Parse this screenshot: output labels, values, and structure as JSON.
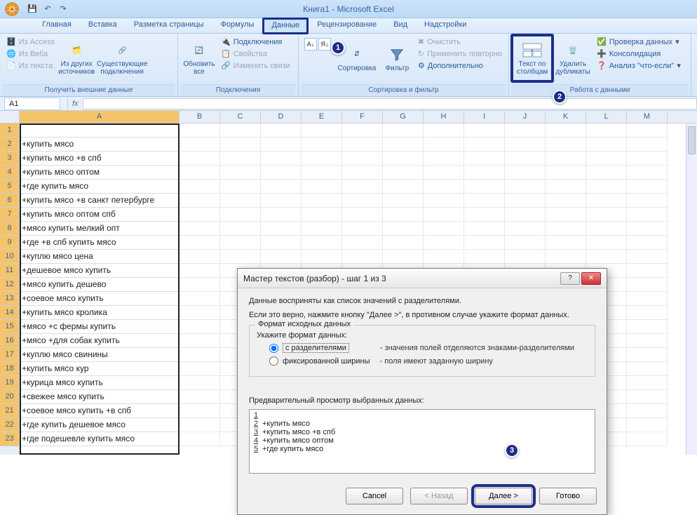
{
  "title": "Книга1  -  Microsoft Excel",
  "qat": {
    "save": "💾",
    "undo": "↶",
    "redo": "↷"
  },
  "tabs": [
    "Главная",
    "Вставка",
    "Разметка страницы",
    "Формулы",
    "Данные",
    "Рецензирование",
    "Вид",
    "Надстройки"
  ],
  "active_tab_index": 4,
  "ribbon": {
    "g_ext": {
      "label": "Получить внешние данные",
      "access": "Из Access",
      "web": "Из Веба",
      "text": "Из текста",
      "other": "Из других источников",
      "existing": "Существующие подключения"
    },
    "g_conn": {
      "label": "Подключения",
      "refresh": "Обновить все",
      "connections": "Подключения",
      "properties": "Свойства",
      "edit_links": "Изменить связи"
    },
    "g_sort": {
      "label": "Сортировка и фильтр",
      "sort": "Сортировка",
      "filter": "Фильтр",
      "clear": "Очистить",
      "reapply": "Применить повторно",
      "advanced": "Дополнительно"
    },
    "g_data": {
      "label": "Работа с данными",
      "text_to_cols": "Текст по столбцам",
      "dedupe": "Удалить дубликаты",
      "validation": "Проверка данных",
      "consolidate": "Консолидация",
      "whatif": "Анализ \"что-если\""
    }
  },
  "namebox": "A1",
  "columns": [
    "A",
    "B",
    "C",
    "D",
    "E",
    "F",
    "G",
    "H",
    "I",
    "J",
    "K",
    "L",
    "M"
  ],
  "rows": [
    "",
    "+купить мясо",
    "+купить мясо +в спб",
    "+купить мясо оптом",
    "+где купить мясо",
    "+купить мясо +в санкт петербурге",
    "+купить мясо оптом спб",
    "+мясо купить мелкий опт",
    "+где +в спб купить мясо",
    "+куплю мясо цена",
    "+дешевое мясо купить",
    "+мясо купить дешево",
    "+соевое мясо купить",
    "+купить мясо кролика",
    "+мясо +с фермы купить",
    "+мясо +для собак купить",
    "+куплю мясо свинины",
    "+купить мясо кур",
    "+курица мясо купить",
    "+свежее мясо купить",
    "+соевое мясо купить +в спб",
    "+где купить дешевое мясо",
    "+где подешевле купить мясо"
  ],
  "dialog": {
    "title": "Мастер текстов (разбор) - шаг 1 из 3",
    "intro1": "Данные восприняты как список значений с разделителями.",
    "intro2": "Если это верно, нажмите кнопку \"Далее >\", в противном случае укажите формат данных.",
    "fieldset_legend": "Формат исходных данных",
    "format_prompt": "Укажите формат данных:",
    "opt_delim": "с разделителями",
    "opt_delim_desc": "- значения полей отделяются знаками-разделителями",
    "opt_fixed": "фиксированной ширины",
    "opt_fixed_desc": "- поля имеют заданную ширину",
    "preview_label": "Предварительный просмотр выбранных данных:",
    "preview_lines": [
      "",
      "+купить мясо",
      "+купить мясо +в спб",
      "+купить мясо оптом",
      "+где купить мясо"
    ],
    "btn_cancel": "Cancel",
    "btn_back": "< Назад",
    "btn_next": "Далее >",
    "btn_finish": "Готово"
  },
  "steps": {
    "1": "1",
    "2": "2",
    "3": "3"
  }
}
